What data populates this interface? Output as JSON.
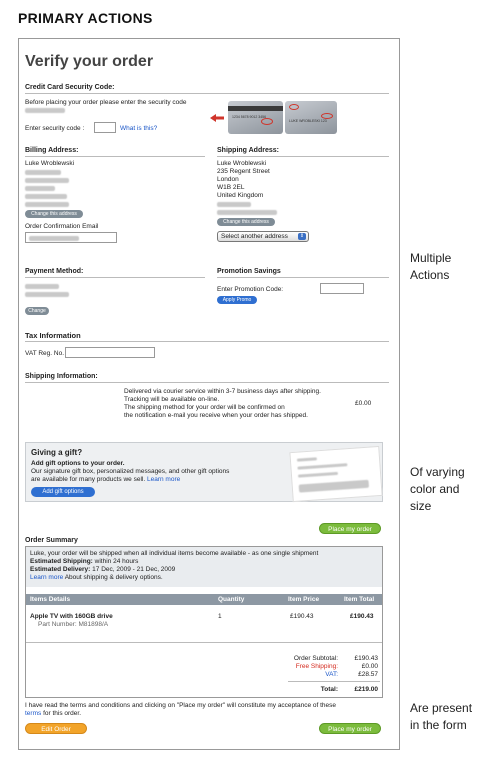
{
  "heading": "PRIMARY ACTIONS",
  "side_notes": {
    "multiple": [
      "Multiple",
      "Actions"
    ],
    "varying": [
      "Of varying",
      "color and",
      "size"
    ],
    "present": [
      "Are present",
      "in the form"
    ]
  },
  "form": {
    "title": "Verify your order",
    "security": {
      "label": "Credit Card Security Code:",
      "instruction": "Before placing your order please enter the security code",
      "code_label": "Enter security code :",
      "what_link": "What is this?",
      "card1_text": "1234 5678 9012 3456",
      "card2_text": "LUKE WROBLESKI 123"
    },
    "billing": {
      "label": "Billing Address:",
      "name": "Luke Wroblewski",
      "change_btn": "Change this address",
      "email_label": "Order Confirmation Email"
    },
    "shipping": {
      "label": "Shipping Address:",
      "lines": [
        "Luke Wroblewski",
        "235 Regent Street",
        "London",
        "W1B 2EL",
        "United Kingdom"
      ],
      "change_btn": "Change this address",
      "select_value": "Select another address"
    },
    "payment": {
      "label": "Payment Method:",
      "change_btn": "Change"
    },
    "promo": {
      "label": "Promotion Savings",
      "code_label": "Enter Promotion Code:",
      "apply_btn": "Apply Promo"
    },
    "tax": {
      "label": "Tax Information",
      "vat_label": "VAT Reg. No."
    },
    "shipping_info": {
      "label": "Shipping Information:",
      "lines": [
        "Delivered via courier service within 3-7 business days after shipping.",
        "Tracking will be available on-line.",
        "The shipping method for your order will be confirmed on",
        "the notification e-mail you receive when your order has shipped."
      ],
      "price": "£0.00"
    },
    "gift": {
      "title": "Giving a gift?",
      "subtitle": "Add gift options to your order.",
      "desc1": "Our signature gift box, personalized messages, and other gift options",
      "desc2": "are available for many products we sell.",
      "learn_more": "Learn more",
      "add_btn": "Add gift options"
    },
    "place_order_top": "Place my order",
    "summary": {
      "label": "Order Summary",
      "intro": "Luke, your order will be shipped when all individual items become available - as one single shipment",
      "est_ship_label": "Estimated Shipping:",
      "est_ship_value": "within 24 hours",
      "est_deliv_label": "Estimated Delivery:",
      "est_deliv_value": "17 Dec, 2009 - 21 Dec, 2009",
      "learn_more": "Learn more",
      "learn_more_rest": "About shipping & delivery options.",
      "columns": [
        "Items Details",
        "Quantity",
        "Item Price",
        "Item Total"
      ],
      "item_name": "Apple TV with 160GB drive",
      "part_number": "Part Number: M81898/A",
      "quantity": "1",
      "item_price": "£190.43",
      "item_total": "£190.43",
      "subtotal_label": "Order Subtotal:",
      "subtotal_value": "£190.43",
      "free_ship_label": "Free Shipping:",
      "free_ship_value": "£0.00",
      "vat_label": "VAT:",
      "vat_value": "£28.57",
      "total_label": "Total:",
      "total_value": "£219.00"
    },
    "terms1": "I have read the terms and conditions and clicking on \"Place my order\" will constitute my acceptance of these",
    "terms_link": "terms",
    "terms2": "for this order.",
    "edit_btn": "Edit Order",
    "place_order_bottom": "Place my order"
  },
  "colors": {
    "green": "#7bbb3c",
    "orange": "#f2a42a",
    "blue": "#2f6fd1",
    "grey": "#7f8c96",
    "arrow": "#d0352b",
    "free_shipping": "#d42a1e"
  }
}
